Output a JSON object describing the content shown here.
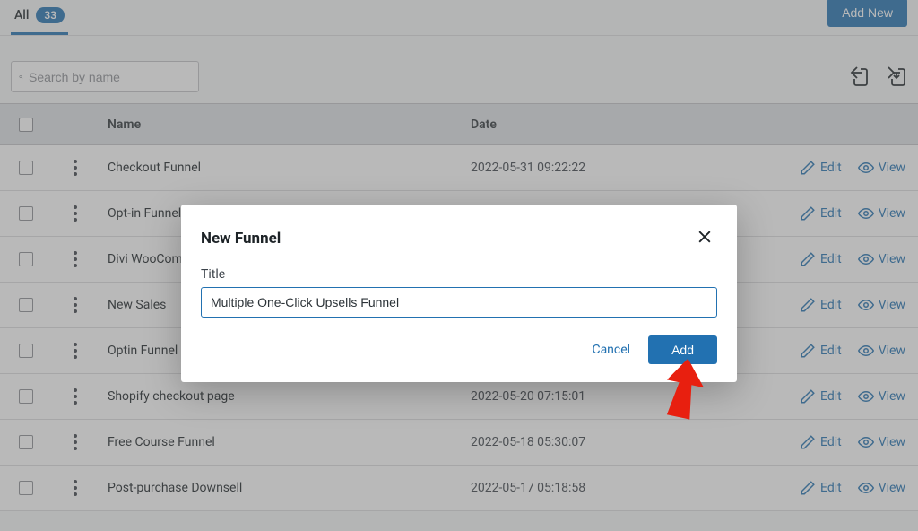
{
  "header": {
    "tab_all_label": "All",
    "tab_all_count": "33",
    "add_new_label": "Add New"
  },
  "search": {
    "placeholder": "Search by name",
    "value": ""
  },
  "table": {
    "headers": {
      "name": "Name",
      "date": "Date"
    },
    "actions": {
      "edit": "Edit",
      "view": "View"
    },
    "rows": [
      {
        "name": "Checkout Funnel",
        "date": "2022-05-31 09:22:22"
      },
      {
        "name": "Opt-in Funnel",
        "date": ""
      },
      {
        "name": "Divi WooCommerce",
        "date": ""
      },
      {
        "name": "New Sales",
        "date": ""
      },
      {
        "name": "Optin Funnel",
        "date": ""
      },
      {
        "name": "Shopify checkout page",
        "date": "2022-05-20 07:15:01"
      },
      {
        "name": "Free Course Funnel",
        "date": "2022-05-18 05:30:07"
      },
      {
        "name": "Post-purchase Downsell",
        "date": "2022-05-17 05:18:58"
      }
    ]
  },
  "modal": {
    "title": "New Funnel",
    "field_label": "Title",
    "field_value": "Multiple One-Click Upsells Funnel",
    "cancel_label": "Cancel",
    "add_label": "Add"
  }
}
